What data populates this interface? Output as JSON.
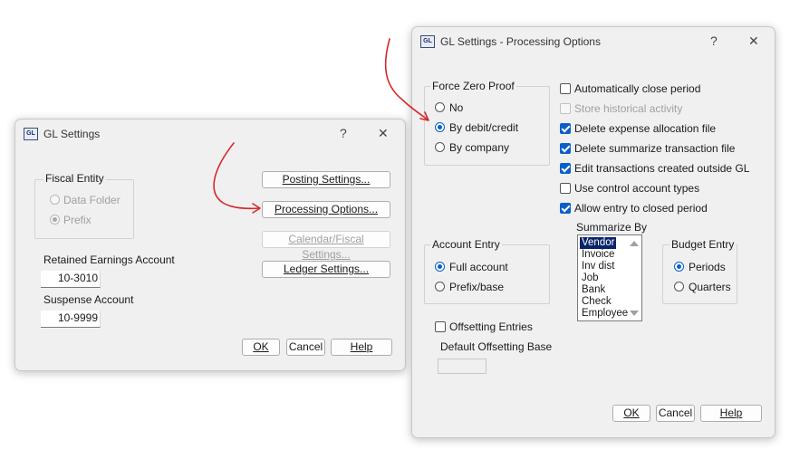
{
  "gl_settings": {
    "title": "GL Settings",
    "icon_text": "GL",
    "help_glyph": "?",
    "close_glyph": "✕",
    "fiscal_entity": {
      "label": "Fiscal Entity",
      "options": [
        "Data Folder",
        "Prefix"
      ],
      "selected": "Prefix"
    },
    "retained_earnings": {
      "label": "Retained Earnings Account",
      "value": "10-3010"
    },
    "suspense": {
      "label": "Suspense Account",
      "value": "10-9999"
    },
    "buttons": {
      "posting": "Posting Settings...",
      "processing": "Processing Options...",
      "calendar": "Calendar/Fiscal Settings...",
      "ledger": "Ledger Settings...",
      "ok": "OK",
      "cancel": "Cancel",
      "help": "Help"
    }
  },
  "processing_options": {
    "title": "GL Settings - Processing Options",
    "icon_text": "GL",
    "help_glyph": "?",
    "close_glyph": "✕",
    "force_zero_proof": {
      "label": "Force Zero Proof",
      "options": [
        "No",
        "By debit/credit",
        "By company"
      ],
      "selected": "By debit/credit"
    },
    "checkboxes": [
      {
        "label": "Automatically close period",
        "checked": false,
        "enabled": true
      },
      {
        "label": "Store historical activity",
        "checked": false,
        "enabled": false
      },
      {
        "label": "Delete expense allocation file",
        "checked": true,
        "enabled": true
      },
      {
        "label": "Delete summarize transaction file",
        "checked": true,
        "enabled": true
      },
      {
        "label": "Edit transactions created outside GL",
        "checked": true,
        "enabled": true
      },
      {
        "label": "Use control account types",
        "checked": false,
        "enabled": true
      },
      {
        "label": "Allow entry to closed period",
        "checked": true,
        "enabled": true
      }
    ],
    "account_entry": {
      "label": "Account Entry",
      "options": [
        "Full account",
        "Prefix/base"
      ],
      "selected": "Full account"
    },
    "summarize_by": {
      "label": "Summarize By",
      "items": [
        "Vendor",
        "Invoice",
        "Inv dist",
        "Job",
        "Bank",
        "Check",
        "Employee"
      ],
      "selected": "Vendor"
    },
    "budget_entry": {
      "label": "Budget Entry",
      "options": [
        "Periods",
        "Quarters"
      ],
      "selected": "Periods"
    },
    "offsetting_entries": {
      "label": "Offsetting Entries",
      "checked": false
    },
    "default_offsetting_base": {
      "label": "Default Offsetting Base",
      "value": ""
    },
    "buttons": {
      "ok": "OK",
      "cancel": "Cancel",
      "help": "Help"
    }
  },
  "annotation_color": "#d42a2a"
}
